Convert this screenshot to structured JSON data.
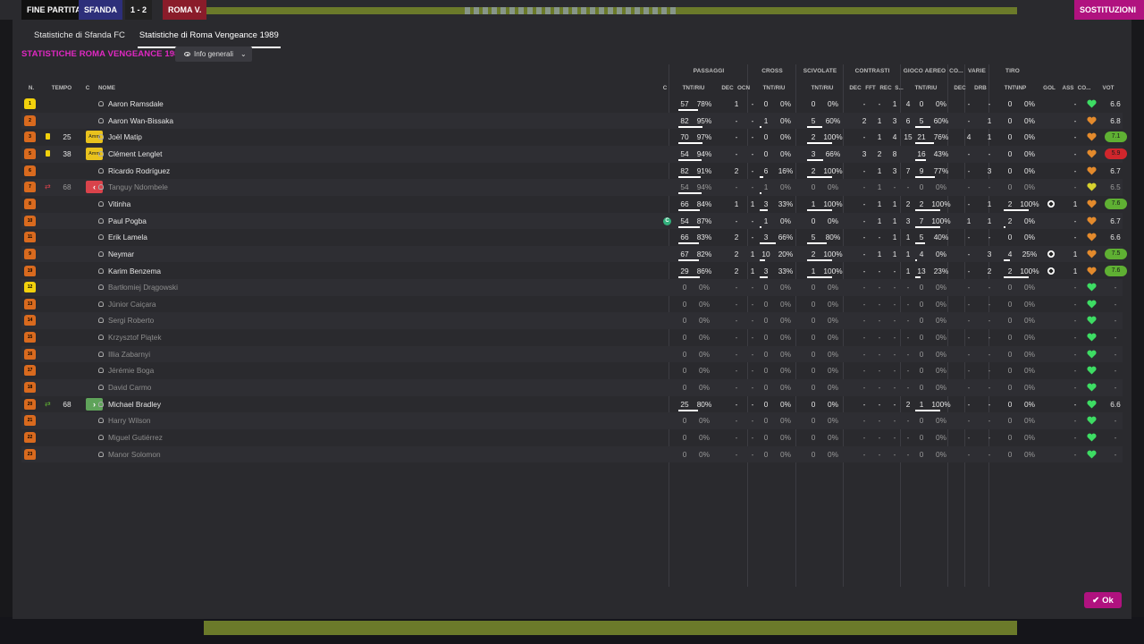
{
  "header": {
    "fine_label": "FINE PARTITA",
    "home_short": "SFANDA",
    "score": "1 - 2",
    "away_short": "ROMA V.",
    "right_score": "1-2",
    "close_label": "×",
    "subs_label": "SOSTITUZIONI"
  },
  "tabs": [
    "Statistiche di Sfanda FC",
    "Statistiche di Roma Vengeance 1989"
  ],
  "team_title": "STATISTICHE ROMA VENGEANCE 1989",
  "view_dropdown": "Info generali",
  "groups": [
    "PASSAGGI",
    "CROSS",
    "SCIVOLATE",
    "CONTRASTI",
    "GIOCO AEREO",
    "CO...",
    "VARIE",
    "TIRO"
  ],
  "columns": {
    "n": "N.",
    "tempo": "TEMPO",
    "c": "C",
    "nome": "NOME",
    "cap": "C",
    "pass_tnt": "TNT/RIU",
    "pass_dec": "DEC",
    "pass_ocn": "OCN",
    "cross_tnt": "TNT/RIU",
    "scv_tnt": "TNT/RIU",
    "con_dec": "DEC",
    "con_fft": "FFT",
    "con_rec": "REC",
    "con_s": "S...",
    "air_tnt": "TNT/RIU",
    "co_dec": "DEC",
    "drb": "DRB",
    "tiro_tnt": "TNT\\INP",
    "gol": "GOL",
    "ass": "ASS",
    "cond": "CO...",
    "vot": "VOT"
  },
  "players": [
    {
      "num": "1",
      "kit": "gk",
      "card": "",
      "tempo": "",
      "badge": "",
      "name": "Aaron Ramsdale",
      "dim": false,
      "cap": false,
      "pass": "57",
      "pass_pct": "78%",
      "pass_frac": 0.78,
      "dec": "1",
      "ocn": "-",
      "cross": "0",
      "cross_pct": "0%",
      "cross_frac": 0,
      "scv": "0",
      "scv_pct": "0%",
      "scv_frac": 0,
      "cdec": "-",
      "fft": "-",
      "rec": "1",
      "s": "4",
      "air": "0",
      "air_pct": "0%",
      "air_frac": 0,
      "codec": "-",
      "drb": "-",
      "tiro": "0",
      "tiro_pct": "0%",
      "tiro_frac": 0,
      "gol": "",
      "ass": "-",
      "cond": "green",
      "vot": "6.6",
      "vot_style": "plain"
    },
    {
      "num": "2",
      "kit": "out",
      "card": "",
      "tempo": "",
      "badge": "",
      "name": "Aaron Wan-Bissaka",
      "dim": false,
      "cap": false,
      "pass": "82",
      "pass_pct": "95%",
      "pass_frac": 0.95,
      "dec": "-",
      "ocn": "-",
      "cross": "1",
      "cross_pct": "0%",
      "cross_frac": 0,
      "scv": "5",
      "scv_pct": "60%",
      "scv_frac": 0.6,
      "cdec": "2",
      "fft": "1",
      "rec": "3",
      "s": "6",
      "air": "5",
      "air_pct": "60%",
      "air_frac": 0.6,
      "codec": "-",
      "drb": "1",
      "tiro": "0",
      "tiro_pct": "0%",
      "tiro_frac": 0,
      "gol": "",
      "ass": "-",
      "cond": "orange",
      "vot": "6.8",
      "vot_style": "plain"
    },
    {
      "num": "3",
      "kit": "out",
      "card": "yellow",
      "tempo": "25",
      "badge": "Amm",
      "name": "Joël Matip",
      "dim": false,
      "cap": false,
      "pass": "70",
      "pass_pct": "97%",
      "pass_frac": 0.97,
      "dec": "-",
      "ocn": "-",
      "cross": "0",
      "cross_pct": "0%",
      "cross_frac": 0,
      "scv": "2",
      "scv_pct": "100%",
      "scv_frac": 1,
      "cdec": "-",
      "fft": "1",
      "rec": "4",
      "s": "15",
      "air": "21",
      "air_pct": "76%",
      "air_frac": 0.76,
      "codec": "4",
      "drb": "1",
      "tiro": "0",
      "tiro_pct": "0%",
      "tiro_frac": 0,
      "gol": "",
      "ass": "-",
      "cond": "orange",
      "vot": "7.1",
      "vot_style": "good"
    },
    {
      "num": "5",
      "kit": "out",
      "card": "yellow",
      "tempo": "38",
      "badge": "Amm",
      "name": "Clément Lenglet",
      "dim": false,
      "cap": false,
      "pass": "54",
      "pass_pct": "94%",
      "pass_frac": 0.94,
      "dec": "-",
      "ocn": "-",
      "cross": "0",
      "cross_pct": "0%",
      "cross_frac": 0,
      "scv": "3",
      "scv_pct": "66%",
      "scv_frac": 0.66,
      "cdec": "3",
      "fft": "2",
      "rec": "8",
      "s": "",
      "air": "16",
      "air_pct": "43%",
      "air_frac": 0.43,
      "codec": "-",
      "drb": "-",
      "tiro": "0",
      "tiro_pct": "0%",
      "tiro_frac": 0,
      "gol": "",
      "ass": "-",
      "cond": "orange",
      "vot": "5.9",
      "vot_style": "bad"
    },
    {
      "num": "6",
      "kit": "out",
      "card": "",
      "tempo": "",
      "badge": "",
      "name": "Ricardo Rodríguez",
      "dim": false,
      "cap": false,
      "pass": "82",
      "pass_pct": "91%",
      "pass_frac": 0.91,
      "dec": "2",
      "ocn": "-",
      "cross": "6",
      "cross_pct": "16%",
      "cross_frac": 0.16,
      "scv": "2",
      "scv_pct": "100%",
      "scv_frac": 1,
      "cdec": "-",
      "fft": "1",
      "rec": "3",
      "s": "7",
      "air": "9",
      "air_pct": "77%",
      "air_frac": 0.77,
      "codec": "-",
      "drb": "3",
      "tiro": "0",
      "tiro_pct": "0%",
      "tiro_frac": 0,
      "gol": "",
      "ass": "-",
      "cond": "orange",
      "vot": "6.7",
      "vot_style": "plain"
    },
    {
      "num": "7",
      "kit": "out",
      "card": "subout",
      "tempo": "68",
      "badge": "out",
      "name": "Tanguy Ndombele",
      "dim": true,
      "cap": false,
      "pass": "54",
      "pass_pct": "94%",
      "pass_frac": 0.94,
      "dec": "-",
      "ocn": "-",
      "cross": "1",
      "cross_pct": "0%",
      "cross_frac": 0,
      "scv": "0",
      "scv_pct": "0%",
      "scv_frac": 0,
      "cdec": "-",
      "fft": "1",
      "rec": "-",
      "s": "-",
      "air": "0",
      "air_pct": "0%",
      "air_frac": 0,
      "codec": "-",
      "drb": "-",
      "tiro": "0",
      "tiro_pct": "0%",
      "tiro_frac": 0,
      "gol": "",
      "ass": "-",
      "cond": "yellow",
      "vot": "6.5",
      "vot_style": "plain"
    },
    {
      "num": "8",
      "kit": "out",
      "card": "",
      "tempo": "",
      "badge": "",
      "name": "Vitinha",
      "dim": false,
      "cap": false,
      "pass": "66",
      "pass_pct": "84%",
      "pass_frac": 0.84,
      "dec": "1",
      "ocn": "1",
      "cross": "3",
      "cross_pct": "33%",
      "cross_frac": 0.33,
      "scv": "1",
      "scv_pct": "100%",
      "scv_frac": 1,
      "cdec": "-",
      "fft": "1",
      "rec": "1",
      "s": "2",
      "air": "2",
      "air_pct": "100%",
      "air_frac": 1,
      "codec": "-",
      "drb": "1",
      "tiro": "2",
      "tiro_pct": "100%",
      "tiro_frac": 1,
      "gol": "ball",
      "ass": "1",
      "cond": "orange",
      "vot": "7.6",
      "vot_style": "good"
    },
    {
      "num": "10",
      "kit": "out",
      "card": "",
      "tempo": "",
      "badge": "",
      "name": "Paul Pogba",
      "dim": false,
      "cap": true,
      "pass": "54",
      "pass_pct": "87%",
      "pass_frac": 0.87,
      "dec": "-",
      "ocn": "-",
      "cross": "1",
      "cross_pct": "0%",
      "cross_frac": 0,
      "scv": "0",
      "scv_pct": "0%",
      "scv_frac": 0,
      "cdec": "-",
      "fft": "1",
      "rec": "1",
      "s": "3",
      "air": "7",
      "air_pct": "100%",
      "air_frac": 1,
      "codec": "1",
      "drb": "1",
      "tiro": "2",
      "tiro_pct": "0%",
      "tiro_frac": 0,
      "gol": "",
      "ass": "-",
      "cond": "orange",
      "vot": "6.7",
      "vot_style": "plain"
    },
    {
      "num": "11",
      "kit": "out",
      "card": "",
      "tempo": "",
      "badge": "",
      "name": "Erik Lamela",
      "dim": false,
      "cap": false,
      "pass": "66",
      "pass_pct": "83%",
      "pass_frac": 0.83,
      "dec": "2",
      "ocn": "-",
      "cross": "3",
      "cross_pct": "66%",
      "cross_frac": 0.66,
      "scv": "5",
      "scv_pct": "80%",
      "scv_frac": 0.8,
      "cdec": "-",
      "fft": "-",
      "rec": "1",
      "s": "1",
      "air": "5",
      "air_pct": "40%",
      "air_frac": 0.4,
      "codec": "-",
      "drb": "-",
      "tiro": "0",
      "tiro_pct": "0%",
      "tiro_frac": 0,
      "gol": "",
      "ass": "-",
      "cond": "orange",
      "vot": "6.6",
      "vot_style": "plain"
    },
    {
      "num": "9",
      "kit": "out",
      "card": "",
      "tempo": "",
      "badge": "",
      "name": "Neymar",
      "dim": false,
      "cap": false,
      "pass": "67",
      "pass_pct": "82%",
      "pass_frac": 0.82,
      "dec": "2",
      "ocn": "1",
      "cross": "10",
      "cross_pct": "20%",
      "cross_frac": 0.2,
      "scv": "2",
      "scv_pct": "100%",
      "scv_frac": 1,
      "cdec": "-",
      "fft": "1",
      "rec": "1",
      "s": "1",
      "air": "4",
      "air_pct": "0%",
      "air_frac": 0,
      "codec": "-",
      "drb": "3",
      "tiro": "4",
      "tiro_pct": "25%",
      "tiro_frac": 0.25,
      "gol": "ball",
      "ass": "1",
      "cond": "orange",
      "vot": "7.5",
      "vot_style": "good"
    },
    {
      "num": "19",
      "kit": "out",
      "card": "",
      "tempo": "",
      "badge": "",
      "name": "Karim Benzema",
      "dim": false,
      "cap": false,
      "pass": "29",
      "pass_pct": "86%",
      "pass_frac": 0.86,
      "dec": "2",
      "ocn": "1",
      "cross": "3",
      "cross_pct": "33%",
      "cross_frac": 0.33,
      "scv": "1",
      "scv_pct": "100%",
      "scv_frac": 1,
      "cdec": "-",
      "fft": "-",
      "rec": "-",
      "s": "1",
      "air": "13",
      "air_pct": "23%",
      "air_frac": 0.23,
      "codec": "-",
      "drb": "2",
      "tiro": "2",
      "tiro_pct": "100%",
      "tiro_frac": 1,
      "gol": "ball",
      "ass": "1",
      "cond": "orange",
      "vot": "7.6",
      "vot_style": "good"
    },
    {
      "num": "12",
      "kit": "gk",
      "card": "",
      "tempo": "",
      "badge": "",
      "name": "Bartłomiej Drągowski",
      "dim": true,
      "cap": false,
      "pass": "0",
      "pass_pct": "0%",
      "pass_frac": 0,
      "dec": "-",
      "ocn": "-",
      "cross": "0",
      "cross_pct": "0%",
      "cross_frac": 0,
      "scv": "0",
      "scv_pct": "0%",
      "scv_frac": 0,
      "cdec": "-",
      "fft": "-",
      "rec": "-",
      "s": "-",
      "air": "0",
      "air_pct": "0%",
      "air_frac": 0,
      "codec": "-",
      "drb": "-",
      "tiro": "0",
      "tiro_pct": "0%",
      "tiro_frac": 0,
      "gol": "",
      "ass": "-",
      "cond": "green",
      "vot": "-",
      "vot_style": "plain"
    },
    {
      "num": "13",
      "kit": "out",
      "card": "",
      "tempo": "",
      "badge": "",
      "name": "Júnior Caiçara",
      "dim": true,
      "cap": false,
      "pass": "0",
      "pass_pct": "0%",
      "pass_frac": 0,
      "dec": "-",
      "ocn": "-",
      "cross": "0",
      "cross_pct": "0%",
      "cross_frac": 0,
      "scv": "0",
      "scv_pct": "0%",
      "scv_frac": 0,
      "cdec": "-",
      "fft": "-",
      "rec": "-",
      "s": "-",
      "air": "0",
      "air_pct": "0%",
      "air_frac": 0,
      "codec": "-",
      "drb": "-",
      "tiro": "0",
      "tiro_pct": "0%",
      "tiro_frac": 0,
      "gol": "",
      "ass": "-",
      "cond": "green",
      "vot": "-",
      "vot_style": "plain"
    },
    {
      "num": "14",
      "kit": "out",
      "card": "",
      "tempo": "",
      "badge": "",
      "name": "Sergi Roberto",
      "dim": true,
      "cap": false,
      "pass": "0",
      "pass_pct": "0%",
      "pass_frac": 0,
      "dec": "-",
      "ocn": "-",
      "cross": "0",
      "cross_pct": "0%",
      "cross_frac": 0,
      "scv": "0",
      "scv_pct": "0%",
      "scv_frac": 0,
      "cdec": "-",
      "fft": "-",
      "rec": "-",
      "s": "-",
      "air": "0",
      "air_pct": "0%",
      "air_frac": 0,
      "codec": "-",
      "drb": "-",
      "tiro": "0",
      "tiro_pct": "0%",
      "tiro_frac": 0,
      "gol": "",
      "ass": "-",
      "cond": "green",
      "vot": "-",
      "vot_style": "plain"
    },
    {
      "num": "15",
      "kit": "out",
      "card": "",
      "tempo": "",
      "badge": "",
      "name": "Krzysztof Piątek",
      "dim": true,
      "cap": false,
      "pass": "0",
      "pass_pct": "0%",
      "pass_frac": 0,
      "dec": "-",
      "ocn": "-",
      "cross": "0",
      "cross_pct": "0%",
      "cross_frac": 0,
      "scv": "0",
      "scv_pct": "0%",
      "scv_frac": 0,
      "cdec": "-",
      "fft": "-",
      "rec": "-",
      "s": "-",
      "air": "0",
      "air_pct": "0%",
      "air_frac": 0,
      "codec": "-",
      "drb": "-",
      "tiro": "0",
      "tiro_pct": "0%",
      "tiro_frac": 0,
      "gol": "",
      "ass": "-",
      "cond": "green",
      "vot": "-",
      "vot_style": "plain"
    },
    {
      "num": "16",
      "kit": "out",
      "card": "",
      "tempo": "",
      "badge": "",
      "name": "Illia Zabarnyi",
      "dim": true,
      "cap": false,
      "pass": "0",
      "pass_pct": "0%",
      "pass_frac": 0,
      "dec": "-",
      "ocn": "-",
      "cross": "0",
      "cross_pct": "0%",
      "cross_frac": 0,
      "scv": "0",
      "scv_pct": "0%",
      "scv_frac": 0,
      "cdec": "-",
      "fft": "-",
      "rec": "-",
      "s": "-",
      "air": "0",
      "air_pct": "0%",
      "air_frac": 0,
      "codec": "-",
      "drb": "-",
      "tiro": "0",
      "tiro_pct": "0%",
      "tiro_frac": 0,
      "gol": "",
      "ass": "-",
      "cond": "green",
      "vot": "-",
      "vot_style": "plain"
    },
    {
      "num": "17",
      "kit": "out",
      "card": "",
      "tempo": "",
      "badge": "",
      "name": "Jérémie Boga",
      "dim": true,
      "cap": false,
      "pass": "0",
      "pass_pct": "0%",
      "pass_frac": 0,
      "dec": "-",
      "ocn": "-",
      "cross": "0",
      "cross_pct": "0%",
      "cross_frac": 0,
      "scv": "0",
      "scv_pct": "0%",
      "scv_frac": 0,
      "cdec": "-",
      "fft": "-",
      "rec": "-",
      "s": "-",
      "air": "0",
      "air_pct": "0%",
      "air_frac": 0,
      "codec": "-",
      "drb": "-",
      "tiro": "0",
      "tiro_pct": "0%",
      "tiro_frac": 0,
      "gol": "",
      "ass": "-",
      "cond": "green",
      "vot": "-",
      "vot_style": "plain"
    },
    {
      "num": "18",
      "kit": "out",
      "card": "",
      "tempo": "",
      "badge": "",
      "name": "David Carmo",
      "dim": true,
      "cap": false,
      "pass": "0",
      "pass_pct": "0%",
      "pass_frac": 0,
      "dec": "-",
      "ocn": "-",
      "cross": "0",
      "cross_pct": "0%",
      "cross_frac": 0,
      "scv": "0",
      "scv_pct": "0%",
      "scv_frac": 0,
      "cdec": "-",
      "fft": "-",
      "rec": "-",
      "s": "-",
      "air": "0",
      "air_pct": "0%",
      "air_frac": 0,
      "codec": "-",
      "drb": "-",
      "tiro": "0",
      "tiro_pct": "0%",
      "tiro_frac": 0,
      "gol": "",
      "ass": "-",
      "cond": "green",
      "vot": "-",
      "vot_style": "plain"
    },
    {
      "num": "20",
      "kit": "out",
      "card": "subin",
      "tempo": "68",
      "badge": "in",
      "name": "Michael Bradley",
      "dim": false,
      "cap": false,
      "pass": "25",
      "pass_pct": "80%",
      "pass_frac": 0.8,
      "dec": "-",
      "ocn": "-",
      "cross": "0",
      "cross_pct": "0%",
      "cross_frac": 0,
      "scv": "0",
      "scv_pct": "0%",
      "scv_frac": 0,
      "cdec": "-",
      "fft": "-",
      "rec": "-",
      "s": "2",
      "air": "1",
      "air_pct": "100%",
      "air_frac": 1,
      "codec": "-",
      "drb": "-",
      "tiro": "0",
      "tiro_pct": "0%",
      "tiro_frac": 0,
      "gol": "",
      "ass": "-",
      "cond": "green",
      "vot": "6.6",
      "vot_style": "plain"
    },
    {
      "num": "21",
      "kit": "out",
      "card": "",
      "tempo": "",
      "badge": "",
      "name": "Harry Wilson",
      "dim": true,
      "cap": false,
      "pass": "0",
      "pass_pct": "0%",
      "pass_frac": 0,
      "dec": "-",
      "ocn": "-",
      "cross": "0",
      "cross_pct": "0%",
      "cross_frac": 0,
      "scv": "0",
      "scv_pct": "0%",
      "scv_frac": 0,
      "cdec": "-",
      "fft": "-",
      "rec": "-",
      "s": "-",
      "air": "0",
      "air_pct": "0%",
      "air_frac": 0,
      "codec": "-",
      "drb": "-",
      "tiro": "0",
      "tiro_pct": "0%",
      "tiro_frac": 0,
      "gol": "",
      "ass": "-",
      "cond": "green",
      "vot": "-",
      "vot_style": "plain"
    },
    {
      "num": "22",
      "kit": "out",
      "card": "",
      "tempo": "",
      "badge": "",
      "name": "Miguel Gutiérrez",
      "dim": true,
      "cap": false,
      "pass": "0",
      "pass_pct": "0%",
      "pass_frac": 0,
      "dec": "-",
      "ocn": "-",
      "cross": "0",
      "cross_pct": "0%",
      "cross_frac": 0,
      "scv": "0",
      "scv_pct": "0%",
      "scv_frac": 0,
      "cdec": "-",
      "fft": "-",
      "rec": "-",
      "s": "-",
      "air": "0",
      "air_pct": "0%",
      "air_frac": 0,
      "codec": "-",
      "drb": "-",
      "tiro": "0",
      "tiro_pct": "0%",
      "tiro_frac": 0,
      "gol": "",
      "ass": "-",
      "cond": "green",
      "vot": "-",
      "vot_style": "plain"
    },
    {
      "num": "23",
      "kit": "out",
      "card": "",
      "tempo": "",
      "badge": "",
      "name": "Manor Solomon",
      "dim": true,
      "cap": false,
      "pass": "0",
      "pass_pct": "0%",
      "pass_frac": 0,
      "dec": "-",
      "ocn": "-",
      "cross": "0",
      "cross_pct": "0%",
      "cross_frac": 0,
      "scv": "0",
      "scv_pct": "0%",
      "scv_frac": 0,
      "cdec": "-",
      "fft": "-",
      "rec": "-",
      "s": "-",
      "air": "0",
      "air_pct": "0%",
      "air_frac": 0,
      "codec": "-",
      "drb": "-",
      "tiro": "0",
      "tiro_pct": "0%",
      "tiro_frac": 0,
      "gol": "",
      "ass": "-",
      "cond": "green",
      "vot": "-",
      "vot_style": "plain"
    }
  ],
  "ok_label": "Ok",
  "colors": {
    "accent": "#b0127f",
    "title": "#e028c2",
    "rating_good": "#5fb033",
    "rating_bad": "#d0262c",
    "card": "#f2d10c"
  }
}
